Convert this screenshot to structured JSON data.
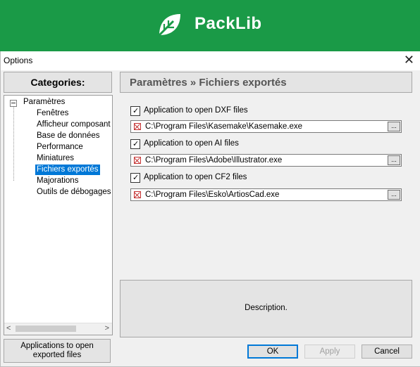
{
  "banner": {
    "brand": "PackLib",
    "bg_color": "#1a9a47"
  },
  "window": {
    "title": "Options",
    "close_glyph": "✕"
  },
  "categories": {
    "header": "Categories:",
    "root": "Paramètres",
    "items": [
      {
        "label": "Fenêtres",
        "selected": false
      },
      {
        "label": "Afficheur composant pa",
        "selected": false
      },
      {
        "label": "Base de données",
        "selected": false
      },
      {
        "label": "Performance",
        "selected": false
      },
      {
        "label": "Miniatures",
        "selected": false
      },
      {
        "label": "Fichiers exportés",
        "selected": true
      },
      {
        "label": "Majorations",
        "selected": false
      },
      {
        "label": "Outils de débogages",
        "selected": false
      }
    ],
    "scroll_left": "<",
    "scroll_right": ">"
  },
  "bottom_left": {
    "label": "Applications to open exported files"
  },
  "settings": {
    "header": "Paramètres » Fichiers exportés",
    "rows": [
      {
        "label": "Application to open DXF files",
        "checked": true,
        "path": "C:\\Program Files\\Kasemake\\Kasemake.exe"
      },
      {
        "label": "Application to open AI files",
        "checked": true,
        "path": "C:\\Program Files\\Adobe\\Illustrator.exe"
      },
      {
        "label": "Application to open CF2 files",
        "checked": true,
        "path": "C:\\Program Files\\Esko\\ArtiosCad.exe"
      }
    ],
    "browse_label": "..."
  },
  "description": {
    "text": "Description."
  },
  "buttons": {
    "ok": "OK",
    "apply": "Apply",
    "cancel": "Cancel"
  }
}
